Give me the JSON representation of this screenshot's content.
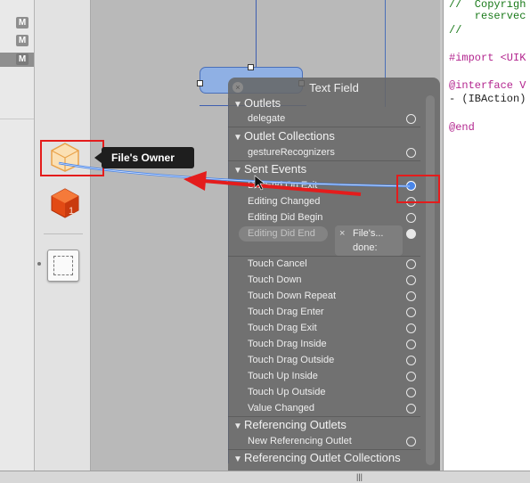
{
  "filenav": {
    "badges": [
      "M",
      "M",
      "M"
    ]
  },
  "canvas": {
    "dragged_object": "text-field"
  },
  "tooltip": {
    "label": "File's Owner"
  },
  "hud": {
    "title": "Text Field",
    "close_glyph": "×",
    "sections": {
      "outlets": "Outlets",
      "outlet_collections": "Outlet Collections",
      "sent_events": "Sent Events",
      "referencing_outlets": "Referencing Outlets",
      "referencing_outlet_collections": "Referencing Outlet Collections"
    },
    "outlets": [
      "delegate"
    ],
    "outlet_collections": [
      "gestureRecognizers"
    ],
    "sent_events_top": [
      "Did End On Exit",
      "Editing Changed",
      "Editing Did Begin",
      "Editing Did End"
    ],
    "sent_events_bottom": [
      "Touch Cancel",
      "Touch Down",
      "Touch Down Repeat",
      "Touch Drag Enter",
      "Touch Drag Exit",
      "Touch Drag Inside",
      "Touch Drag Outside",
      "Touch Up Inside",
      "Touch Up Outside",
      "Value Changed"
    ],
    "referencing_outlets": [
      "New Referencing Outlet"
    ],
    "connection": {
      "close_glyph": "×",
      "target": "File's...",
      "action": "done:"
    }
  },
  "editor": {
    "lines": [
      {
        "text": "//  Copyrigh",
        "kind": "comment"
      },
      {
        "text": "    reservec",
        "kind": "comment"
      },
      {
        "text": "//",
        "kind": "comment"
      },
      {
        "text": "",
        "kind": "text"
      },
      {
        "text": "#import <UIK",
        "kind": "import"
      },
      {
        "text": "",
        "kind": "text"
      },
      {
        "text": "@interface V",
        "kind": "keyword"
      },
      {
        "text": "- (IBAction)",
        "kind": "action"
      },
      {
        "text": "",
        "kind": "text"
      },
      {
        "text": "@end",
        "kind": "keyword"
      }
    ]
  },
  "colors": {
    "annotation_red": "#e41c1c",
    "connection_blue": "#4a86e8",
    "hud_bg": "#666666",
    "object_blue": "#8fb0e4"
  },
  "icons": [
    "files-owner-cube-icon",
    "first-responder-cube-icon",
    "view-placeholder-icon",
    "hud-close-icon",
    "disclosure-triangle-icon",
    "connection-ring-icon",
    "resize-grip-icon"
  ]
}
